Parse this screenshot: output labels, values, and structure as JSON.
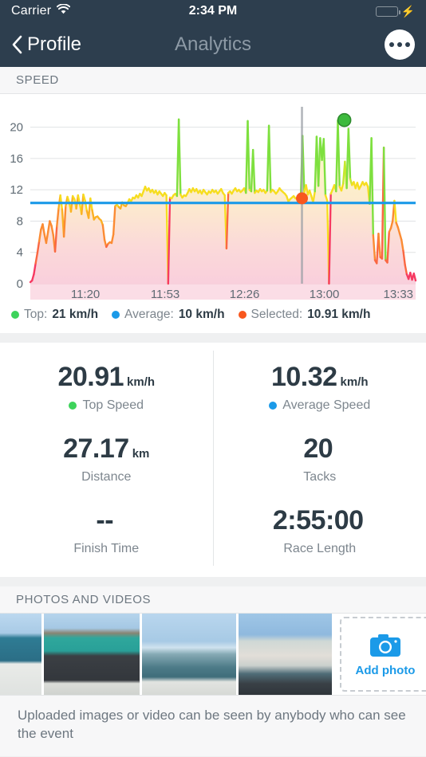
{
  "statusbar": {
    "carrier": "Carrier",
    "wifi_icon": "wifi-icon",
    "time": "2:34 PM",
    "battery_icon": "battery-icon",
    "charging_icon": "charging-bolt-icon"
  },
  "navbar": {
    "back_label": "Profile",
    "back_icon": "chevron-left-icon",
    "title": "Analytics",
    "more_icon": "more-horizontal-icon"
  },
  "speed_section": {
    "header": "SPEED",
    "legend": [
      {
        "label": "Top:",
        "value": "21 km/h",
        "color": "#3dd35b"
      },
      {
        "label": "Average:",
        "value": "10 km/h",
        "color": "#1b9ae8"
      },
      {
        "label": "Selected:",
        "value": "10.91 km/h",
        "color": "#f8571e"
      }
    ]
  },
  "chart_data": {
    "type": "area",
    "title": "SPEED",
    "xlabel": "",
    "ylabel": "km/h",
    "ylim": [
      0,
      22
    ],
    "yticks": [
      0,
      4,
      8,
      12,
      16,
      20
    ],
    "grid": true,
    "legend_position": "below",
    "x_tick_labels": [
      "11:20",
      "11:53",
      "12:26",
      "13:00",
      "13:33"
    ],
    "x_tick_positions": [
      0.143,
      0.35,
      0.556,
      0.763,
      0.955
    ],
    "average_line": 10.32,
    "average_line_color": "#1b9ae8",
    "selected_marker": {
      "x": 0.705,
      "y": 10.91,
      "color": "#f8571e"
    },
    "top_marker": {
      "x": 0.815,
      "y": 20.91,
      "color": "#3dba3d"
    },
    "selection_line_x": 0.705,
    "selection_line_color": "#9aa0a6",
    "series": [
      {
        "name": "Speed",
        "unit": "km/h",
        "values": [
          0.2,
          0.4,
          1.2,
          2.6,
          3.9,
          5.4,
          6.9,
          7.6,
          6.3,
          5.2,
          6.6,
          8.0,
          7.4,
          6.2,
          4.1,
          7.3,
          9.6,
          11.3,
          9.5,
          6.0,
          9.9,
          11.1,
          10.4,
          9.2,
          11.2,
          10.8,
          9.6,
          11.3,
          10.2,
          8.9,
          11.4,
          10.6,
          9.3,
          8.4,
          10.9,
          9.4,
          8.2,
          8.5,
          8.6,
          8.3,
          8.1,
          7.5,
          5.6,
          4.7,
          5.1,
          5.3,
          5.2,
          6.3,
          9.9,
          10.1,
          9.8,
          9.6,
          10.4,
          10.0,
          9.9,
          10.3,
          10.8,
          10.5,
          11.0,
          10.9,
          11.3,
          11.0,
          11.5,
          11.2,
          11.8,
          12.4,
          11.9,
          12.2,
          11.7,
          12.0,
          11.6,
          11.9,
          11.4,
          11.8,
          11.5,
          11.2,
          11.6,
          11.3,
          0.0,
          11.0,
          10.9,
          11.3,
          11.5,
          11.2,
          21.0,
          11.4,
          11.0,
          11.3,
          11.2,
          11.6,
          12.1,
          11.7,
          12.2,
          11.8,
          12.1,
          11.6,
          11.9,
          11.5,
          12.0,
          11.7,
          11.4,
          11.8,
          11.6,
          12.0,
          11.7,
          11.9,
          11.5,
          11.8,
          12.1,
          11.6,
          11.3,
          4.5,
          11.6,
          11.8,
          11.5,
          11.9,
          12.2,
          11.8,
          12.0,
          11.7,
          11.9,
          12.2,
          11.6,
          20.8,
          12.0,
          11.8,
          17.1,
          11.6,
          11.9,
          11.7,
          12.1,
          11.8,
          12.0,
          11.6,
          11.9,
          20.2,
          11.7,
          12.0,
          11.8,
          11.5,
          11.8,
          12.2,
          11.9,
          11.7,
          11.5,
          11.2,
          10.5,
          10.8,
          11.0,
          11.2,
          10.9,
          10.95,
          11.1,
          10.91,
          18.9,
          11.7,
          12.6,
          11.4,
          11.9,
          11.2,
          10.4,
          11.8,
          18.8,
          12.5,
          18.6,
          15.8,
          18.5,
          11.3,
          10.6,
          0.0,
          11.5,
          12.0,
          12.6,
          11.8,
          20.9,
          12.4,
          11.9,
          12.8,
          15.6,
          12.2,
          19.8,
          13.4,
          12.6,
          13.0,
          12.2,
          12.9,
          12.1,
          12.5,
          13.0,
          12.6,
          12.9,
          12.4,
          10.2,
          18.6,
          6.2,
          3.0,
          2.6,
          6.4,
          3.4,
          3.2,
          17.4,
          3.0,
          2.7,
          6.6,
          7.1,
          8.0,
          10.6,
          7.8,
          7.2,
          6.4,
          5.6,
          4.2,
          2.4,
          1.2,
          0.6,
          1.4,
          0.5,
          1.3,
          0.4
        ]
      }
    ]
  },
  "stats": [
    [
      {
        "value": "20.91",
        "unit": "km/h",
        "label": "Top Speed",
        "dot_color": "#3dd35b"
      },
      {
        "value": "10.32",
        "unit": "km/h",
        "label": "Average Speed",
        "dot_color": "#1b9ae8"
      }
    ],
    [
      {
        "value": "27.17",
        "unit": "km",
        "label": "Distance",
        "dot_color": ""
      },
      {
        "value": "20",
        "unit": "",
        "label": "Tacks",
        "dot_color": ""
      }
    ],
    [
      {
        "value": "--",
        "unit": "",
        "label": "Finish Time",
        "dot_color": ""
      },
      {
        "value": "2:55:00",
        "unit": "",
        "label": "Race Length",
        "dot_color": ""
      }
    ]
  ],
  "photos_section": {
    "header": "PHOTOS AND VIDEOS",
    "thumbnails": [
      {
        "alt": "sailboat-bow-sea-photo"
      },
      {
        "alt": "sailor-red-cap-photo"
      },
      {
        "alt": "deck-horizon-photo"
      },
      {
        "alt": "woman-white-jacket-photo"
      }
    ],
    "add_photo_label": "Add photo",
    "add_photo_icon": "camera-icon",
    "footer_note": "Uploaded images or video can be seen by anybody who can see the event"
  }
}
